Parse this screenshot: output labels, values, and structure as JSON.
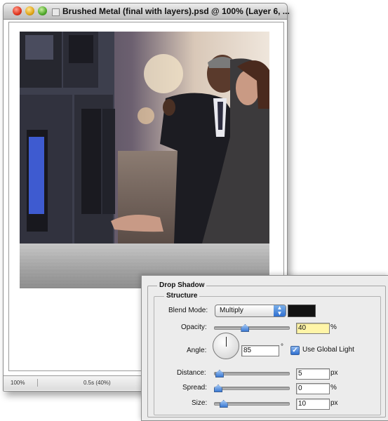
{
  "window": {
    "title": "Brushed Metal (final with layers).psd @ 100% (Layer 6, ..."
  },
  "status_bar": {
    "zoom": "100%",
    "doc_info": "0.5s (40%)"
  },
  "dialog": {
    "section_title": "Drop Shadow",
    "subsection_title": "Structure",
    "blend_mode": {
      "label": "Blend Mode:",
      "value": "Multiply",
      "color": "#121212"
    },
    "opacity": {
      "label": "Opacity:",
      "value": "40",
      "unit": "%",
      "level": 0.4
    },
    "angle": {
      "label": "Angle:",
      "value": "85",
      "unit": "°"
    },
    "use_global_light": {
      "label": "Use Global Light",
      "checked": true
    },
    "distance": {
      "label": "Distance:",
      "value": "5",
      "unit": "px",
      "level": 0.02
    },
    "spread": {
      "label": "Spread:",
      "value": "0",
      "unit": "%",
      "level": 0.0
    },
    "size": {
      "label": "Size:",
      "value": "10",
      "unit": "px",
      "level": 0.08
    }
  },
  "colors": {
    "accent": "#3a78d6",
    "highlight_field": "#fff5a8"
  },
  "icons": {
    "close": "close-icon",
    "minimize": "minimize-icon",
    "zoom": "zoom-icon",
    "proxy": "document-proxy-icon",
    "popup_arrows": "updown-arrows-icon",
    "checkmark": "checkmark-icon"
  }
}
